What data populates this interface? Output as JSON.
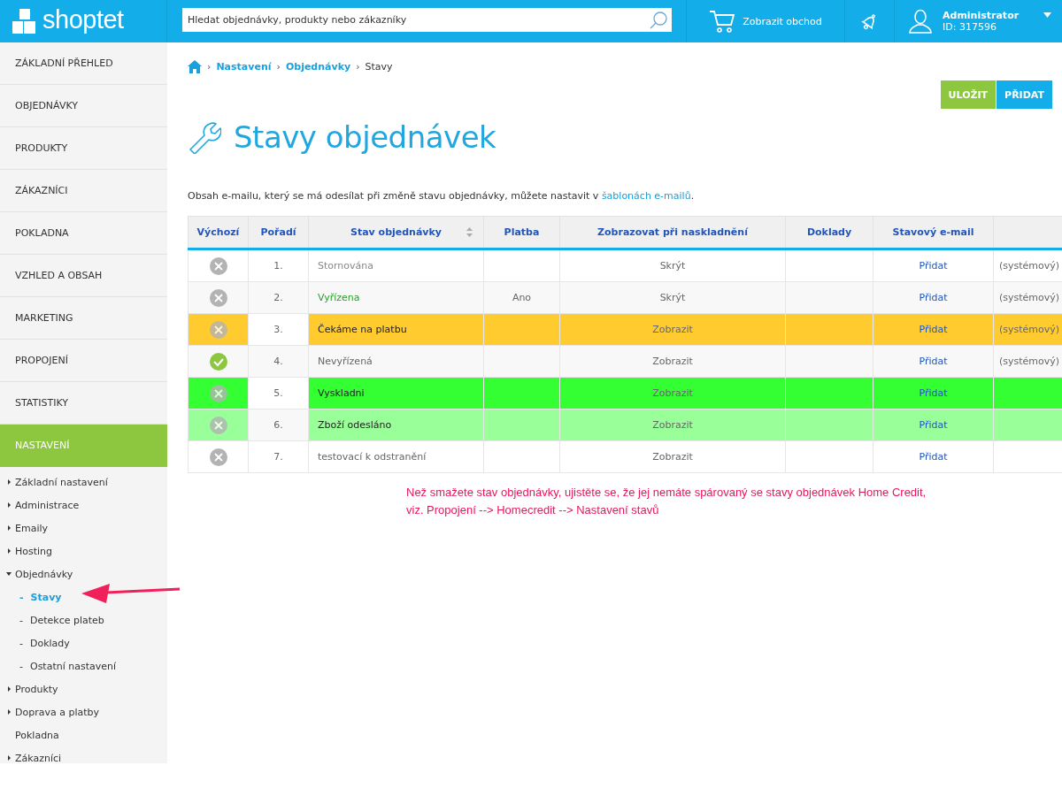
{
  "header": {
    "logo": "shoptet",
    "search": {
      "placeholder": "Hledat objednávky, produkty nebo zákazníky"
    },
    "shop_link": "Zobrazit obchod",
    "user": {
      "name": "Administrator",
      "id": "ID: 317596"
    }
  },
  "sidebar": {
    "items": [
      {
        "label": "ZÁKLADNÍ PŘEHLED",
        "selected": false
      },
      {
        "label": "OBJEDNÁVKY",
        "selected": false
      },
      {
        "label": "PRODUKTY",
        "selected": false
      },
      {
        "label": "ZÁKAZNÍCI",
        "selected": false
      },
      {
        "label": "POKLADNA",
        "selected": false
      },
      {
        "label": "VZHLED A OBSAH",
        "selected": false
      },
      {
        "label": "MARKETING",
        "selected": false
      },
      {
        "label": "PROPOJENÍ",
        "selected": false
      },
      {
        "label": "STATISTIKY",
        "selected": false
      },
      {
        "label": "NASTAVENÍ",
        "selected": true
      }
    ],
    "tree": [
      {
        "label": "Základní nastavení",
        "kind": "folder",
        "expanded": false
      },
      {
        "label": "Administrace",
        "kind": "folder",
        "expanded": false
      },
      {
        "label": "Emaily",
        "kind": "folder",
        "expanded": false
      },
      {
        "label": "Hosting",
        "kind": "folder",
        "expanded": false
      },
      {
        "label": "Objednávky",
        "kind": "folder",
        "expanded": true,
        "children": [
          {
            "bullet": "-",
            "label": "Stavy",
            "selected": true
          },
          {
            "bullet": "-",
            "label": "Detekce plateb",
            "selected": false
          },
          {
            "bullet": "-",
            "label": "Doklady",
            "selected": false
          },
          {
            "bullet": "-",
            "label": "Ostatní nastavení",
            "selected": false
          }
        ]
      },
      {
        "label": "Produkty",
        "kind": "folder",
        "expanded": false
      },
      {
        "label": "Doprava a platby",
        "kind": "folder",
        "expanded": false
      },
      {
        "label": "Pokladna",
        "kind": "leaf"
      },
      {
        "label": "Zákazníci",
        "kind": "folder",
        "expanded": false
      }
    ]
  },
  "breadcrumb": [
    {
      "separator": "›",
      "label": "Nastavení",
      "kind": "link"
    },
    {
      "separator": "›",
      "label": "Objednávky",
      "kind": "link"
    },
    {
      "separator": "›",
      "label": "Stavy",
      "kind": "current"
    }
  ],
  "buttons": [
    {
      "label": "ULOŽIT",
      "kind": "save"
    },
    {
      "label": "PŘIDAT",
      "kind": "add"
    }
  ],
  "title": "Stavy objednávek",
  "intro": {
    "text": "Obsah e-mailu, který se má odesílat při změně stavu objednávky, můžete nastavit v ",
    "link": "šablonách e-mailů",
    "after": "."
  },
  "table": {
    "columns": [
      "Výchozí",
      "Pořadí",
      "Stav objednávky",
      "Platba",
      "Zobrazovat při naskladnění",
      "Doklady",
      "Stavový e-mail"
    ],
    "rows": [
      {
        "default": false,
        "order": "1.",
        "name": "Stornována",
        "kind": "muted",
        "stock": "Skrýt",
        "email": "Přidat",
        "system": "(systémový)"
      },
      {
        "default": false,
        "order": "2.",
        "name": "Vyřízena",
        "kind": "success",
        "payment": "Ano",
        "stock": "Skrýt",
        "email": "Přidat",
        "system": "(systémový)"
      },
      {
        "default": false,
        "order": "3.",
        "name": "Čekáme na platbu",
        "kind": "plain",
        "stock": "Zobrazit",
        "email": "Přidat",
        "system": "(systémový)",
        "color": "#ffcb2f"
      },
      {
        "default": true,
        "order": "4.",
        "name": "Nevyřízená",
        "kind": "plain",
        "stock": "Zobrazit",
        "email": "Přidat",
        "system": "(systémový)"
      },
      {
        "default": false,
        "order": "5.",
        "name": "Vyskladni",
        "kind": "plain",
        "stock": "Zobrazit",
        "email": "Přidat",
        "color": "#33ff33"
      },
      {
        "default": false,
        "order": "6.",
        "name": "Zboží odesláno",
        "kind": "plain",
        "stock": "Zobrazit",
        "email": "Přidat",
        "color": "#99ff99"
      },
      {
        "default": false,
        "order": "7.",
        "name": "testovací k odstranění",
        "kind": "plain",
        "stock": "Zobrazit",
        "email": "Přidat"
      }
    ]
  },
  "note": [
    "Než smažete stav objednávky, ujistěte se, že jej nemáte spárovaný se stavy objednávek Home Credit,",
    "viz. Propojení --> Homecredit --> Nastavení stavů"
  ]
}
